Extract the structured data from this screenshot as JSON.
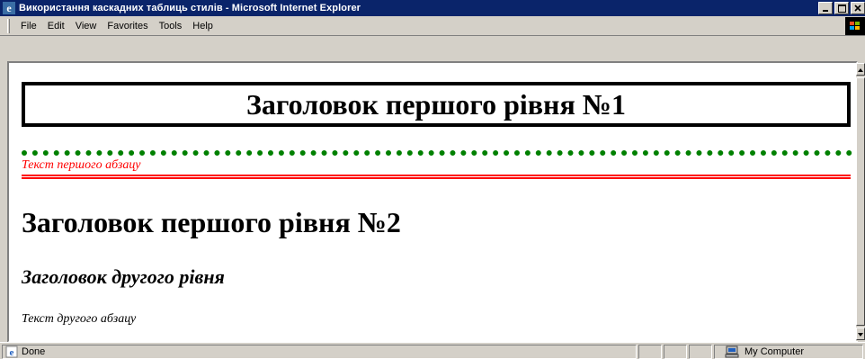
{
  "window": {
    "title": "Використання каскадних таблиць стилів - Microsoft Internet Explorer",
    "app_icon": "ie-icon",
    "controls": [
      "minimize-icon",
      "maximize-icon",
      "close-icon"
    ]
  },
  "menu": {
    "items": [
      {
        "label": "File"
      },
      {
        "label": "Edit"
      },
      {
        "label": "View"
      },
      {
        "label": "Favorites"
      },
      {
        "label": "Tools"
      },
      {
        "label": "Help"
      }
    ],
    "throbber_icon": "windows-logo-icon"
  },
  "page": {
    "heading1_boxed": "Заголовок першого рівня №1",
    "paragraph1": "Текст першого абзацу",
    "heading1_plain": "Заголовок першого рівня №2",
    "heading2": "Заголовок другого рівня",
    "paragraph2": "Текст другого абзацу"
  },
  "colors": {
    "titlebar": "#0a246a",
    "dotted_rule": "#008000",
    "paragraph1_text": "#ff0000",
    "double_rule": "#ff0000"
  },
  "status": {
    "text": "Done",
    "zone": "My Computer",
    "status_icon": "ie-page-icon",
    "zone_icon": "computer-icon"
  }
}
